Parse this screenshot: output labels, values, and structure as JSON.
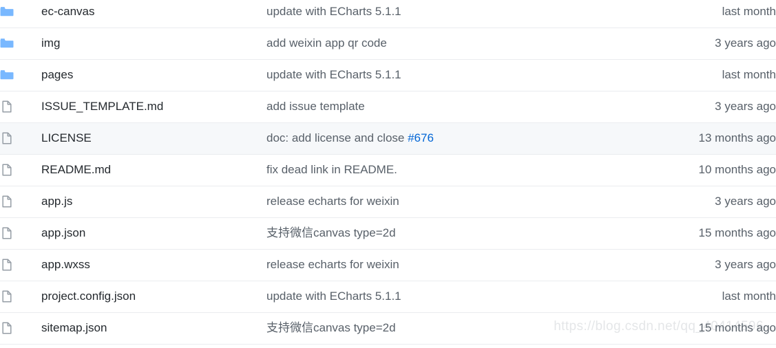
{
  "file_list": {
    "columns": [
      "icon",
      "name",
      "message",
      "time"
    ],
    "icons": {
      "folder": "folder-icon",
      "file": "file-icon"
    },
    "colors": {
      "folder_icon": "#79b8ff",
      "file_icon": "#959da5",
      "link": "#0366d6",
      "name_text": "#24292e",
      "muted_text": "#586069",
      "row_divider": "#eaecef",
      "row_highlight": "#f6f8fa"
    },
    "rows": [
      {
        "icon": "folder-icon",
        "name": "ec-canvas",
        "message": "update with ECharts 5.1.1",
        "link": "",
        "time": "last month",
        "highlighted": false
      },
      {
        "icon": "folder-icon",
        "name": "img",
        "message": "add weixin app qr code",
        "link": "",
        "time": "3 years ago",
        "highlighted": false
      },
      {
        "icon": "folder-icon",
        "name": "pages",
        "message": "update with ECharts 5.1.1",
        "link": "",
        "time": "last month",
        "highlighted": false
      },
      {
        "icon": "file-icon",
        "name": "ISSUE_TEMPLATE.md",
        "message": "add issue template",
        "link": "",
        "time": "3 years ago",
        "highlighted": false
      },
      {
        "icon": "file-icon",
        "name": "LICENSE",
        "message": "doc: add license and close ",
        "link": "#676",
        "time": "13 months ago",
        "highlighted": true
      },
      {
        "icon": "file-icon",
        "name": "README.md",
        "message": "fix dead link in README.",
        "link": "",
        "time": "10 months ago",
        "highlighted": false
      },
      {
        "icon": "file-icon",
        "name": "app.js",
        "message": "release echarts for weixin",
        "link": "",
        "time": "3 years ago",
        "highlighted": false
      },
      {
        "icon": "file-icon",
        "name": "app.json",
        "message": "支持微信canvas type=2d",
        "link": "",
        "time": "15 months ago",
        "highlighted": false
      },
      {
        "icon": "file-icon",
        "name": "app.wxss",
        "message": "release echarts for weixin",
        "link": "",
        "time": "3 years ago",
        "highlighted": false
      },
      {
        "icon": "file-icon",
        "name": "project.config.json",
        "message": "update with ECharts 5.1.1",
        "link": "",
        "time": "last month",
        "highlighted": false
      },
      {
        "icon": "file-icon",
        "name": "sitemap.json",
        "message": "支持微信canvas type=2d",
        "link": "",
        "time": "15 months ago",
        "highlighted": false
      }
    ]
  },
  "watermark": {
    "text": "https://blog.csdn.net/qq_40414596"
  }
}
